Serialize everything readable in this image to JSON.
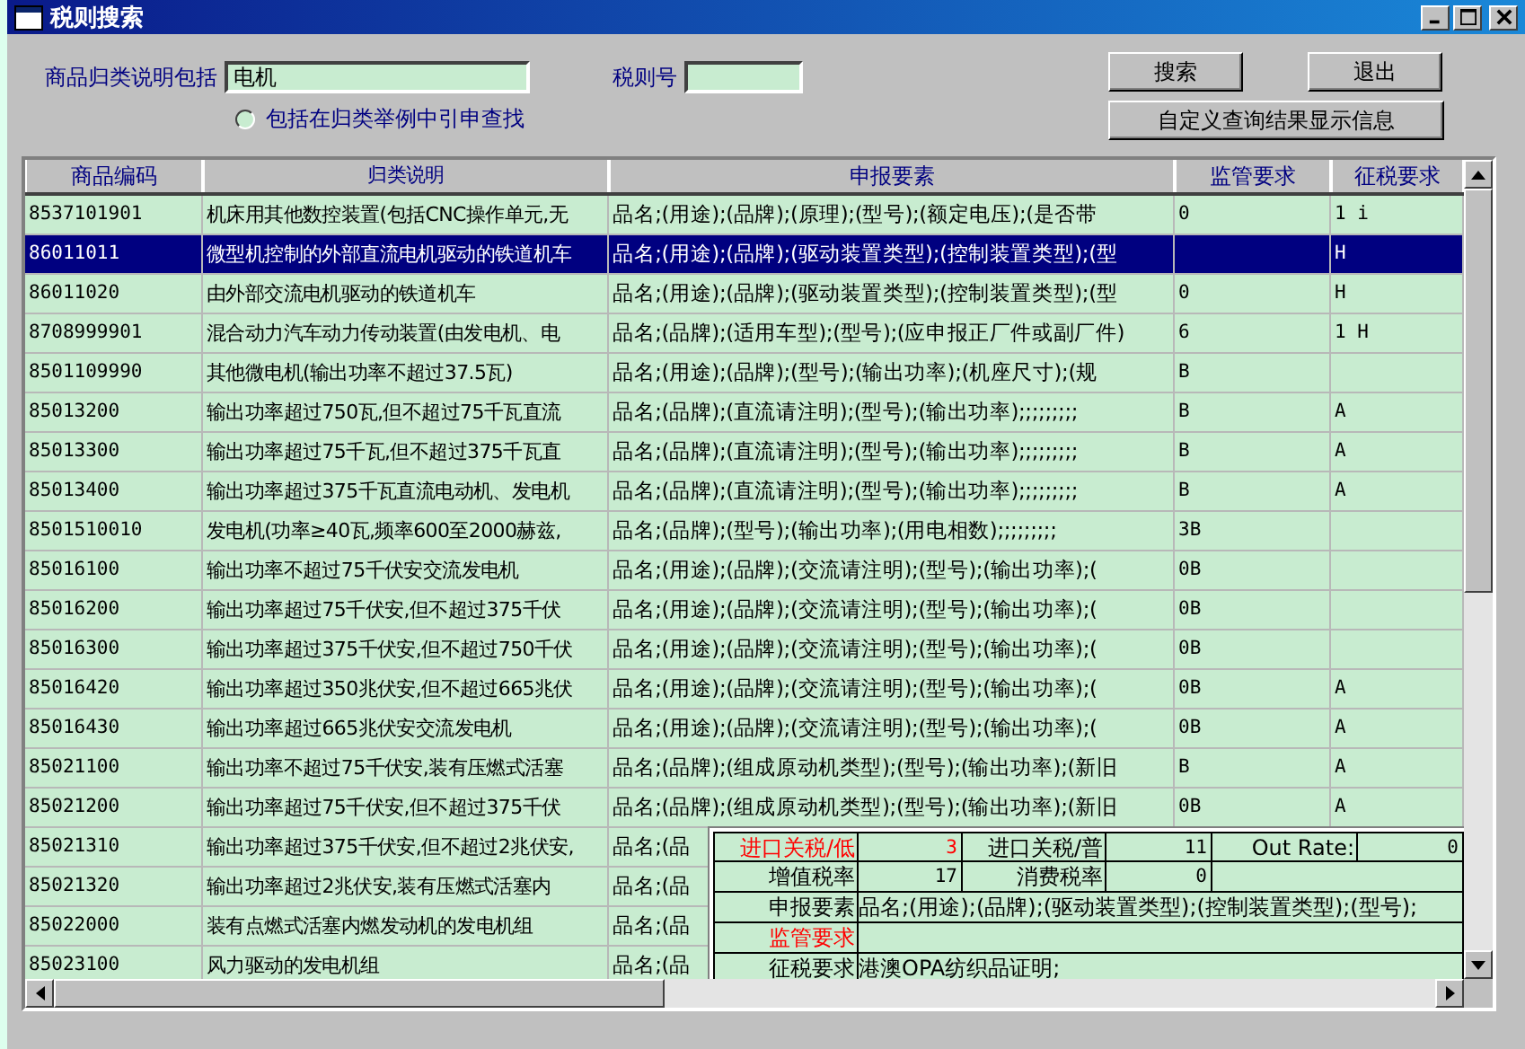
{
  "window": {
    "title": "税则搜索"
  },
  "search": {
    "desc_label": "商品归类说明包括",
    "desc_value": "电机",
    "code_label": "税则号",
    "radio": {
      "label": "包括在归类举例中引申查找",
      "checked": false
    }
  },
  "buttons": {
    "search": "搜索",
    "exit": "退出",
    "custom": "自定义查询结果显示信息"
  },
  "table": {
    "columns": [
      "商品编码",
      "归类说明",
      "申报要素",
      "监管要求",
      "征税要求"
    ],
    "rows": [
      {
        "code": "8537101901",
        "desc": "机床用其他数控装置(包括CNC操作单元,无",
        "elements": "品名;(用途);(品牌);(原理);(型号);(额定电压);(是否带",
        "supervision": "0",
        "tax": "1  i",
        "selected": false
      },
      {
        "code": "86011011",
        "desc": "微型机控制的外部直流电机驱动的铁道机车",
        "elements": "品名;(用途);(品牌);(驱动装置类型);(控制装置类型);(型",
        "tax": "H",
        "selected": true
      },
      {
        "code": "86011020",
        "desc": "由外部交流电机驱动的铁道机车",
        "elements": "品名;(用途);(品牌);(驱动装置类型);(控制装置类型);(型",
        "supervision": "0",
        "tax": "H",
        "selected": false
      },
      {
        "code": "8708999901",
        "desc": "混合动力汽车动力传动装置(由发电机、电",
        "elements": "品名;(品牌);(适用车型);(型号);(应申报正厂件或副厂件)",
        "supervision": "6",
        "tax": "1  H",
        "selected": false
      },
      {
        "code": "8501109990",
        "desc": "其他微电机(输出功率不超过37.5瓦)",
        "elements": "品名;(用途);(品牌);(型号);(输出功率);(机座尺寸);(规",
        "supervision": "B",
        "selected": false
      },
      {
        "code": "85013200",
        "desc": "输出功率超过750瓦,但不超过75千瓦直流",
        "elements": "品名;(品牌);(直流请注明);(型号);(输出功率);;;;;;;;;",
        "supervision": "B",
        "tax": "A",
        "selected": false
      },
      {
        "code": "85013300",
        "desc": "输出功率超过75千瓦,但不超过375千瓦直",
        "elements": "品名;(品牌);(直流请注明);(型号);(输出功率);;;;;;;;;",
        "supervision": "B",
        "tax": "A",
        "selected": false
      },
      {
        "code": "85013400",
        "desc": "输出功率超过375千瓦直流电动机、发电机",
        "elements": "品名;(品牌);(直流请注明);(型号);(输出功率);;;;;;;;;",
        "supervision": "B",
        "tax": "A",
        "selected": false
      },
      {
        "code": "8501510010",
        "desc": "发电机(功率≥40瓦,频率600至2000赫兹,",
        "elements": "品名;(品牌);(型号);(输出功率);(用电相数);;;;;;;;;",
        "supervision": "3B",
        "selected": false
      },
      {
        "code": "85016100",
        "desc": "输出功率不超过75千伏安交流发电机",
        "elements": "品名;(用途);(品牌);(交流请注明);(型号);(输出功率);(",
        "supervision": "0B",
        "selected": false
      },
      {
        "code": "85016200",
        "desc": "输出功率超过75千伏安,但不超过375千伏",
        "elements": "品名;(用途);(品牌);(交流请注明);(型号);(输出功率);(",
        "supervision": "0B",
        "selected": false
      },
      {
        "code": "85016300",
        "desc": "输出功率超过375千伏安,但不超过750千伏",
        "elements": "品名;(用途);(品牌);(交流请注明);(型号);(输出功率);(",
        "supervision": "0B",
        "selected": false
      },
      {
        "code": "85016420",
        "desc": "输出功率超过350兆伏安,但不超过665兆伏",
        "elements": "品名;(用途);(品牌);(交流请注明);(型号);(输出功率);(",
        "supervision": "0B",
        "tax": "A",
        "selected": false
      },
      {
        "code": "85016430",
        "desc": "输出功率超过665兆伏安交流发电机",
        "elements": "品名;(用途);(品牌);(交流请注明);(型号);(输出功率);(",
        "supervision": "0B",
        "tax": "A",
        "selected": false
      },
      {
        "code": "85021100",
        "desc": "输出功率不超过75千伏安,装有压燃式活塞",
        "elements": "品名;(品牌);(组成原动机类型);(型号);(输出功率);(新旧",
        "supervision": "B",
        "tax": "A",
        "selected": false
      },
      {
        "code": "85021200",
        "desc": "输出功率超过75千伏安,但不超过375千伏",
        "elements": "品名;(品牌);(组成原动机类型);(型号);(输出功率);(新旧",
        "supervision": "0B",
        "tax": "A",
        "selected": false
      },
      {
        "code": "85021310",
        "desc": "输出功率超过375千伏安,但不超过2兆伏安,",
        "elements": "品名;(品",
        "selected": false
      },
      {
        "code": "85021320",
        "desc": "输出功率超过2兆伏安,装有压燃式活塞内",
        "elements": "品名;(品",
        "selected": false
      },
      {
        "code": "85022000",
        "desc": "装有点燃式活塞内燃发动机的发电机组",
        "elements": "品名;(品",
        "selected": false
      },
      {
        "code": "85023100",
        "desc": "风力驱动的发电机组",
        "elements": "品名;(品",
        "selected": false
      }
    ]
  },
  "detail": {
    "rates": [
      {
        "label": "进口关税/低",
        "value": "3",
        "alert": true
      },
      {
        "label": "进口关税/普",
        "value": "11",
        "alert": false
      },
      {
        "label": "Out Rate:",
        "value": "0",
        "alert": false
      },
      {
        "label": "增值税率",
        "value": "17",
        "alert": false
      },
      {
        "label": "消费税率",
        "value": "0",
        "alert": false
      }
    ],
    "lines": [
      {
        "label": "申报要素",
        "value": "品名;(用途);(品牌);(驱动装置类型);(控制装置类型);(型号);",
        "alert": false
      },
      {
        "label": "监管要求",
        "alert": true
      },
      {
        "label": "征税要求",
        "value": "港澳OPA纺织品证明;",
        "alert": false
      }
    ]
  }
}
